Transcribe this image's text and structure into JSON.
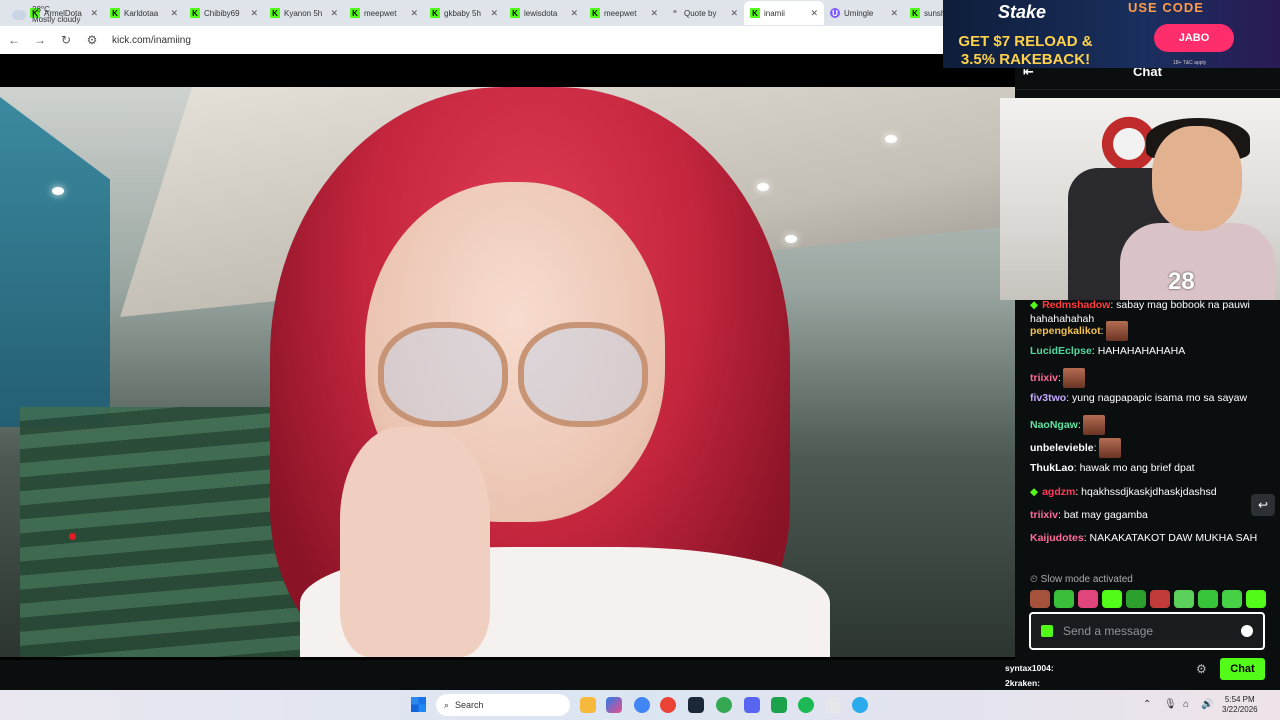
{
  "browser": {
    "tabs": [
      {
        "label": "ArmelDota",
        "fav": "K"
      },
      {
        "label": "Karldotaa",
        "fav": "K"
      },
      {
        "label": "Chibiby69",
        "fav": "K"
      },
      {
        "label": "Kyanon 5h",
        "fav": "K"
      },
      {
        "label": "meepwet",
        "fav": "K"
      },
      {
        "label": "gkbaby 5h",
        "fav": "K"
      },
      {
        "label": "lewisdota",
        "fav": "K"
      },
      {
        "label": "meepwet",
        "fav": "K"
      },
      {
        "label": "Quote by",
        "fav": "“"
      },
      {
        "label": "inamii",
        "fav": "K",
        "active": true
      },
      {
        "label": "Umingle",
        "fav": "U"
      },
      {
        "label": "sunsh",
        "fav": "K"
      }
    ],
    "url": "kick.com/inamiing"
  },
  "ad": {
    "brand": "Stake",
    "promo": "GET $7 RELOAD & 3.5% RAKEBACK!",
    "code_label": "USE CODE",
    "code": "JABO",
    "terms": "18+ T&C apply"
  },
  "chat": {
    "title": "Chat",
    "messages": [
      {
        "user": "Redmshadow",
        "text": ": sabay mag bobook na pauwi hahahahahah",
        "color": "#ff3b3b",
        "badge": true
      },
      {
        "user": "pepengkalikot",
        "text": ":",
        "color": "#f2c14e",
        "emote": true
      },
      {
        "user": "LucidEclpse",
        "text": ": HAHAHAHAHAHA",
        "color": "#53d8a0"
      },
      {
        "user": "triixiv",
        "text": ":",
        "color": "#ff6b9a",
        "emote": true
      },
      {
        "user": "fiv3two",
        "text": ": yung nagpapapic isama mo sa sayaw",
        "color": "#c4a7ff"
      },
      {
        "user": "NaoNgaw",
        "text": ":",
        "color": "#5fe3a1",
        "emote": true
      },
      {
        "user": "unbelevieble",
        "text": ":",
        "color": "#ffffff",
        "emote": true
      },
      {
        "user": "ThukLao",
        "text": ": hawak mo ang brief dpat",
        "color": "#ffffff"
      },
      {
        "user": "agdzm",
        "text": ": hqakhssdjkaskjdhaskjdashsd",
        "color": "#ff3b5c",
        "badge": true
      },
      {
        "user": "triixiv",
        "text": ": bat may gagamba",
        "color": "#ff6b9a"
      },
      {
        "user": "Kaijudotes",
        "text": ": NAKAKATAKOT DAW MUKHA SAH",
        "color": "#ff6b9a"
      }
    ],
    "slow_mode": "Slow mode activated",
    "input_placeholder": "Send a message",
    "send_label": "Chat",
    "mini_users": [
      {
        "user": "syntax1004",
        "text": ":"
      },
      {
        "user": "2kraken",
        "text": ":"
      }
    ]
  },
  "taskbar": {
    "weather_temp": "28°C",
    "weather_desc": "Mostly cloudy",
    "search_label": "Search",
    "time": "5:54 PM",
    "date": "3/22/2026"
  },
  "colors": {
    "accent": "#53fc18",
    "chat_bg": "#0b0e0f"
  }
}
